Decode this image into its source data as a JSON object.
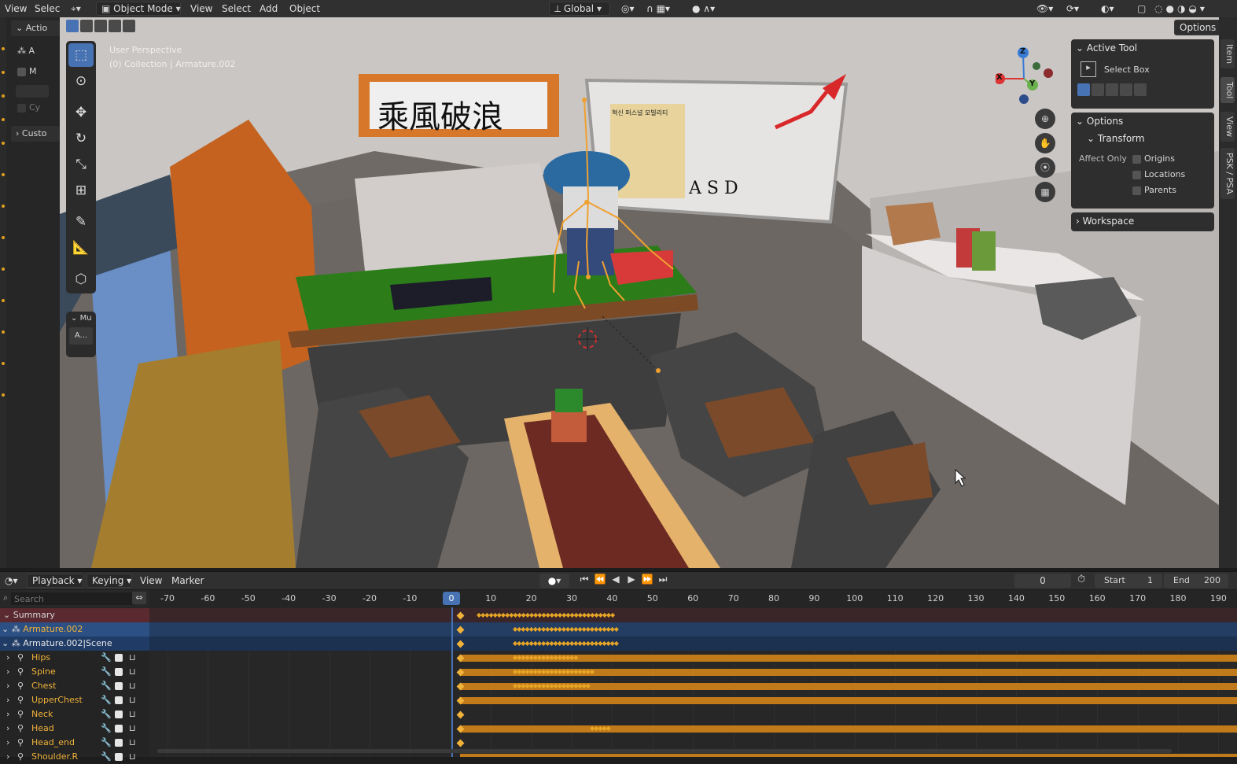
{
  "header": {
    "menu": [
      "View",
      "Selec"
    ],
    "mode": "Object Mode",
    "menus": [
      "View",
      "Select",
      "Add",
      "Object"
    ],
    "orientation": "Global",
    "options": "Options"
  },
  "left_panel": {
    "action": "Actio",
    "a": "A",
    "m": "M",
    "cy": "Cy",
    "custom": "Custo",
    "mu": "Mu",
    "a_btn": "A..."
  },
  "viewport": {
    "perspective": "User Perspective",
    "collection": "(0) Collection | Armature.002",
    "sign_text": "乘風破浪",
    "board_text": "혁신 퍼스널 모빌리티",
    "board_keys": "A S D",
    "colors": {
      "floor": "#6f6a66",
      "desk": "#2c7d1a",
      "cabinet": "#d2d0d0"
    }
  },
  "gizmo": {
    "x": "X",
    "y": "Y",
    "z": "Z"
  },
  "npanel": {
    "active_tool": "Active Tool",
    "select_box": "Select Box",
    "options": "Options",
    "transform": "Transform",
    "affect_only": "Affect Only",
    "origins": "Origins",
    "locations": "Locations",
    "parents": "Parents",
    "workspace": "Workspace"
  },
  "side_tabs": [
    "Item",
    "Tool",
    "View",
    "PSK / PSA"
  ],
  "timeline": {
    "playback": "Playback",
    "keying": "Keying",
    "view": "View",
    "marker": "Marker",
    "current_frame": "0",
    "start_label": "Start",
    "start": "1",
    "end_label": "End",
    "end": "200",
    "search_placeholder": "Search",
    "ruler": [
      "-70",
      "-60",
      "-50",
      "-40",
      "-30",
      "-20",
      "-10",
      "0",
      "10",
      "20",
      "30",
      "40",
      "50",
      "60",
      "70",
      "80",
      "90",
      "100",
      "110",
      "120",
      "130",
      "140",
      "150",
      "160",
      "170",
      "180",
      "190"
    ],
    "channels": {
      "summary": "Summary",
      "armature": "Armature.002",
      "scene": "Armature.002|Scene",
      "bones": [
        "Hips",
        "Spine",
        "Chest",
        "UpperChest",
        "Neck",
        "Head",
        "Head_end",
        "Shoulder.R"
      ]
    }
  }
}
